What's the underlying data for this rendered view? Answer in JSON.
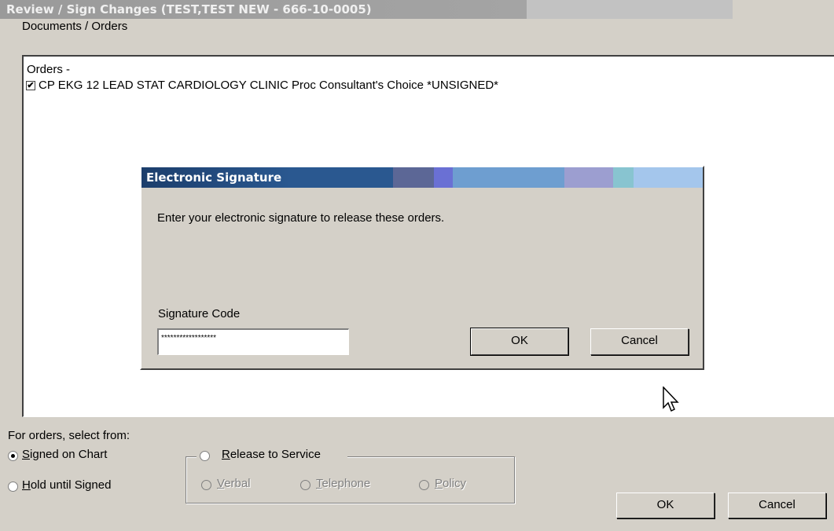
{
  "window": {
    "title": "Review / Sign Changes  (TEST,TEST NEW - 666-10-0005)"
  },
  "documents_label": "Documents / Orders",
  "orders": {
    "header": "Orders -",
    "items": [
      {
        "checked": true,
        "text": "CP EKG 12 LEAD STAT CARDIOLOGY CLINIC Proc Consultant's Choice *UNSIGNED*"
      }
    ]
  },
  "signature_dialog": {
    "title": "Electronic Signature",
    "message": "Enter your electronic signature to release these orders.",
    "code_label": "Signature Code",
    "code_value": "******************",
    "ok_label": "OK",
    "cancel_label": "Cancel"
  },
  "bottom": {
    "select_label": "For orders, select from:",
    "options": {
      "signed_on_chart": {
        "label": "Signed on Chart",
        "selected": true
      },
      "hold_until_signed": {
        "label": "Hold until Signed",
        "selected": false
      },
      "release_to_service": {
        "label": "Release to Service",
        "selected": false
      },
      "verbal": {
        "label": "Verbal",
        "enabled": false
      },
      "telephone": {
        "label": "Telephone",
        "enabled": false
      },
      "policy": {
        "label": "Policy",
        "enabled": false
      }
    },
    "ok_label": "OK",
    "cancel_label": "Cancel"
  }
}
